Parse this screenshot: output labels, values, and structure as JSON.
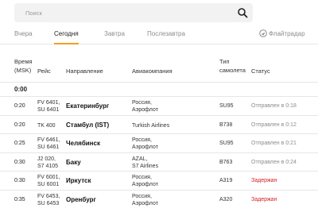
{
  "search": {
    "placeholder": "Поиск"
  },
  "tabs": [
    {
      "label": "Вчера",
      "active": false
    },
    {
      "label": "Сегодня",
      "active": true
    },
    {
      "label": "Завтра",
      "active": false
    },
    {
      "label": "Послезавтра",
      "active": false
    }
  ],
  "flightradar": {
    "label": "Флайтрадар"
  },
  "columns": {
    "time_line1": "Время",
    "time_line2": "(MSK)",
    "flight": "Рейс",
    "destination": "Направление",
    "airline": "Авиакомпания",
    "type_line1": "Тип",
    "type_line2": "самолета",
    "status": "Статус"
  },
  "group": {
    "label": "0:00"
  },
  "flights": [
    {
      "time": "0:20",
      "flight_l1": "FV 6401,",
      "flight_l2": "SU 6401",
      "destination": "Екатеринбург",
      "airline_l1": "Россия,",
      "airline_l2": "Аэрофлот",
      "aircraft": "SU95",
      "status": "Отправлен в 0:18",
      "status_kind": "departed"
    },
    {
      "time": "0:20",
      "flight_l1": "TK 400",
      "flight_l2": "",
      "destination": "Стамбул (IST)",
      "airline_l1": "Turkish Airlines",
      "airline_l2": "",
      "aircraft": "B738",
      "status": "Отправлен в 0:12",
      "status_kind": "departed"
    },
    {
      "time": "0:25",
      "flight_l1": "FV 6461,",
      "flight_l2": "SU 6461",
      "destination": "Челябинск",
      "airline_l1": "Россия,",
      "airline_l2": "Аэрофлот",
      "aircraft": "SU95",
      "status": "Отправлен в 0:21",
      "status_kind": "departed"
    },
    {
      "time": "0:30",
      "flight_l1": "J2 020,",
      "flight_l2": "S7 4105",
      "destination": "Баку",
      "airline_l1": "AZAL,",
      "airline_l2": "S7 Airlines",
      "aircraft": "B763",
      "status": "Отправлен в 0:24",
      "status_kind": "departed"
    },
    {
      "time": "0:30",
      "flight_l1": "FV 6001,",
      "flight_l2": "SU 6001",
      "destination": "Иркутск",
      "airline_l1": "Россия,",
      "airline_l2": "Аэрофлот",
      "aircraft": "A319",
      "status": "Задержан",
      "status_kind": "delayed"
    },
    {
      "time": "0:35",
      "flight_l1": "FV 6453,",
      "flight_l2": "SU 6453",
      "destination": "Оренбург",
      "airline_l1": "Россия,",
      "airline_l2": "Аэрофлот",
      "aircraft": "A320",
      "status": "Задержан",
      "status_kind": "delayed"
    }
  ],
  "colors": {
    "accent": "#f0a020",
    "delayed": "#d42020",
    "muted": "#8c8c8c"
  }
}
